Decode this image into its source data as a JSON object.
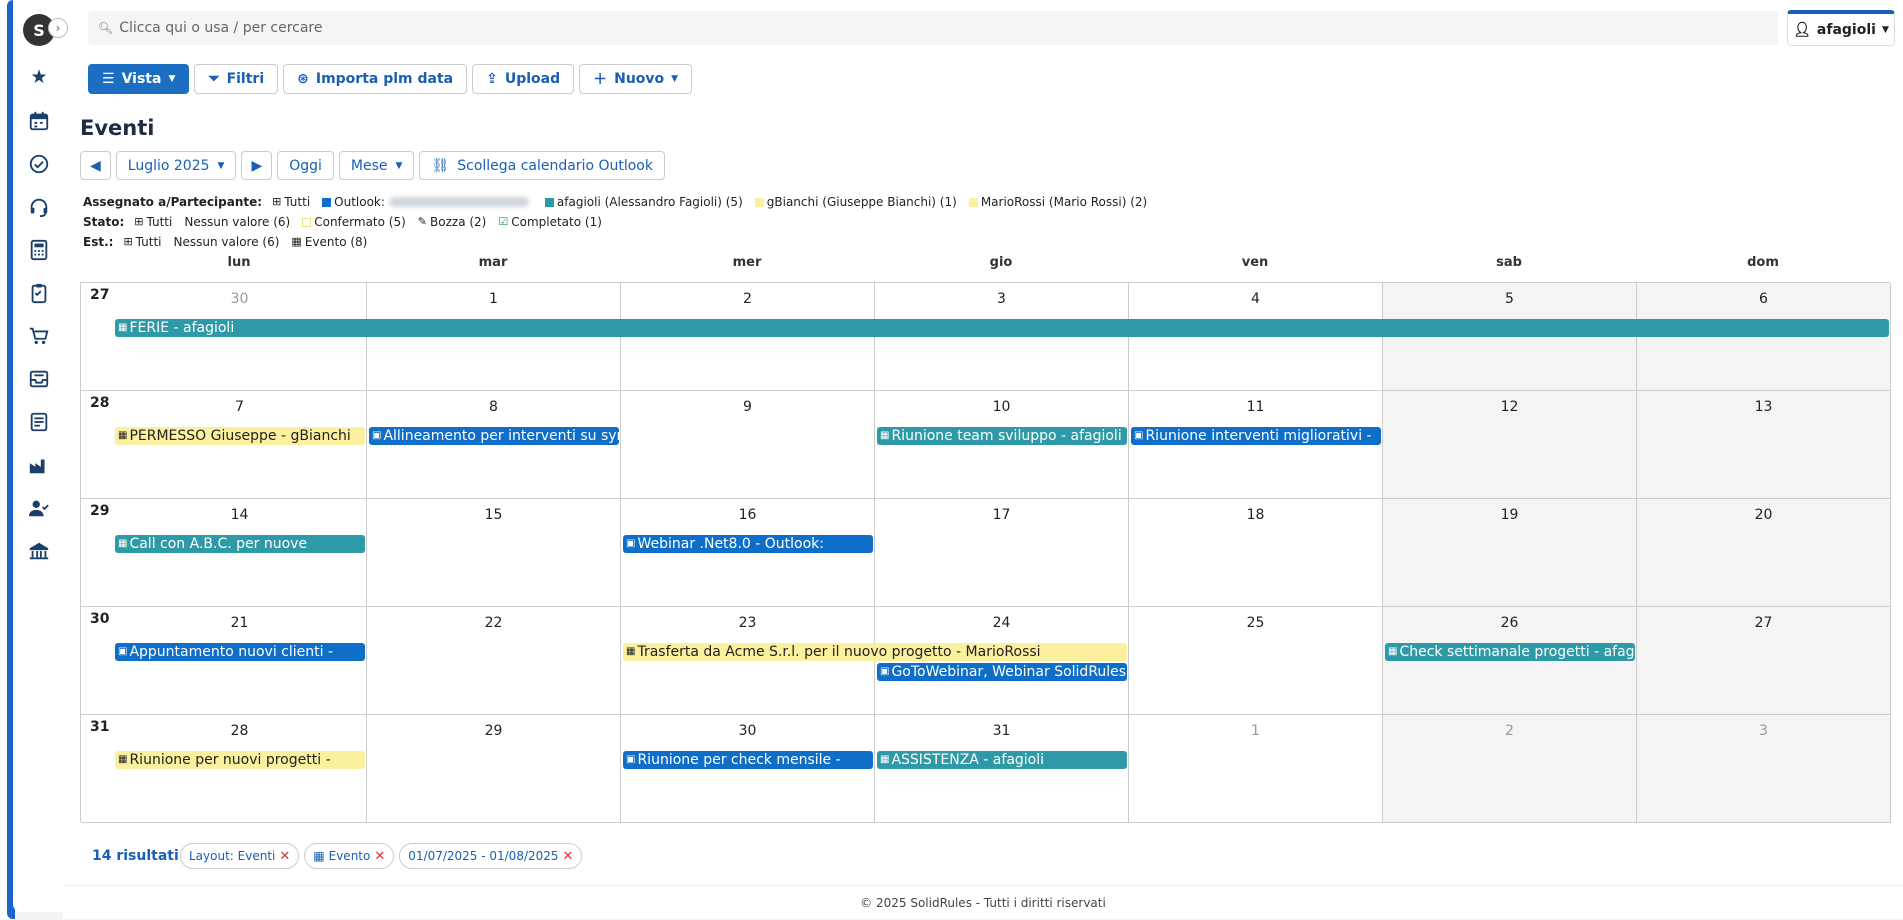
{
  "search": {
    "placeholder": "Clicca qui o usa / per cercare"
  },
  "user": {
    "name": "afagioli"
  },
  "toolbar": {
    "vista": "Vista",
    "filtri": "Filtri",
    "importa": "Importa plm data",
    "upload": "Upload",
    "nuovo": "Nuovo"
  },
  "page": {
    "title": "Eventi"
  },
  "nav": {
    "month_label": "Luglio 2025",
    "oggi": "Oggi",
    "mese": "Mese",
    "outlook": "Scollega calendario Outlook"
  },
  "filters": {
    "assegnato": {
      "label": "Assegnato a/Partecipante:",
      "tutti": "Tutti",
      "outlook": "Outlook:",
      "afagioli": "afagioli (Alessandro Fagioli) (5)",
      "gbianchi": "gBianchi (Giuseppe Bianchi) (1)",
      "mariorossi": "MarioRossi (Mario Rossi) (2)"
    },
    "stato": {
      "label": "Stato:",
      "tutti": "Tutti",
      "nessun": "Nessun valore (6)",
      "confermato": "Confermato (5)",
      "bozza": "Bozza (2)",
      "completato": "Completato (1)"
    },
    "est": {
      "label": "Est.:",
      "tutti": "Tutti",
      "nessun": "Nessun valore (6)",
      "evento": "Evento (8)"
    }
  },
  "colors": {
    "teal": "#2f9aa7",
    "blue": "#0e6ec8",
    "yellow": "#fbf09e",
    "accent": "#1b6ec2"
  },
  "days_of_week": [
    "lun",
    "mar",
    "mer",
    "gio",
    "ven",
    "sab",
    "dom"
  ],
  "weeks": [
    {
      "number": "27",
      "days": [
        "30",
        "1",
        "2",
        "3",
        "4",
        "5",
        "6"
      ]
    },
    {
      "number": "28",
      "days": [
        "7",
        "8",
        "9",
        "10",
        "11",
        "12",
        "13"
      ]
    },
    {
      "number": "29",
      "days": [
        "14",
        "15",
        "16",
        "17",
        "18",
        "19",
        "20"
      ]
    },
    {
      "number": "30",
      "days": [
        "21",
        "22",
        "23",
        "24",
        "25",
        "26",
        "27"
      ]
    },
    {
      "number": "31",
      "days": [
        "28",
        "29",
        "30",
        "31",
        "1",
        "2",
        "3"
      ]
    }
  ],
  "events": [
    {
      "title": "FERIE - afagioli",
      "week": 0,
      "start": 0,
      "span": 7,
      "row": 0,
      "color": "teal"
    },
    {
      "title": "PERMESSO Giuseppe - gBianchi",
      "week": 1,
      "start": 0,
      "span": 1,
      "row": 0,
      "color": "yellow"
    },
    {
      "title": "Allineamento per interventi su sync",
      "week": 1,
      "start": 1,
      "span": 1,
      "row": 0,
      "color": "blue"
    },
    {
      "title": "Riunione team sviluppo - afagioli",
      "week": 1,
      "start": 3,
      "span": 1,
      "row": 0,
      "color": "teal"
    },
    {
      "title": "Riunione interventi migliorativi -",
      "week": 1,
      "start": 4,
      "span": 1,
      "row": 0,
      "color": "blue"
    },
    {
      "title": "Call con A.B.C. per nuove",
      "week": 2,
      "start": 0,
      "span": 1,
      "row": 0,
      "color": "teal"
    },
    {
      "title": "Webinar .Net8.0 - Outlook:",
      "week": 2,
      "start": 2,
      "span": 1,
      "row": 0,
      "color": "blue"
    },
    {
      "title": "Appuntamento nuovi clienti -",
      "week": 3,
      "start": 0,
      "span": 1,
      "row": 0,
      "color": "blue"
    },
    {
      "title": "Trasferta da Acme S.r.l. per il nuovo progetto - MarioRossi",
      "week": 3,
      "start": 2,
      "span": 2,
      "row": 0,
      "color": "yellow"
    },
    {
      "title": "GoToWebinar, Webinar SolidRules:",
      "week": 3,
      "start": 3,
      "span": 1,
      "row": 1,
      "color": "blue"
    },
    {
      "title": "Check settimanale progetti - afagioli",
      "week": 3,
      "start": 5,
      "span": 1,
      "row": 0,
      "color": "teal"
    },
    {
      "title": "Riunione per nuovi progetti -",
      "week": 4,
      "start": 0,
      "span": 1,
      "row": 0,
      "color": "yellow"
    },
    {
      "title": "Riunione per check mensile -",
      "week": 4,
      "start": 2,
      "span": 1,
      "row": 0,
      "color": "blue"
    },
    {
      "title": "ASSISTENZA - afagioli",
      "week": 4,
      "start": 3,
      "span": 1,
      "row": 0,
      "color": "teal"
    }
  ],
  "results": {
    "label": "14 risultati"
  },
  "chips": [
    {
      "label": "Layout: Eventi"
    },
    {
      "label": "Evento"
    },
    {
      "label": "01/07/2025 - 01/08/2025"
    }
  ],
  "footer": {
    "text": "© 2025  SolidRules  - Tutti i diritti riservati"
  }
}
